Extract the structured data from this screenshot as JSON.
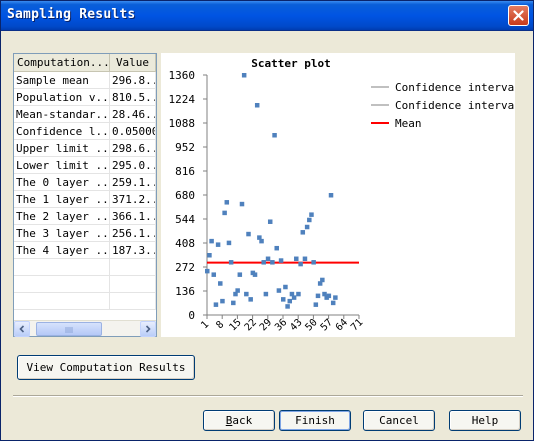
{
  "window": {
    "title": "Sampling Results"
  },
  "grid": {
    "headers": [
      "Computation...",
      "Value"
    ],
    "rows": [
      [
        "Sample mean",
        "296.8..."
      ],
      [
        "Population v...",
        "810.5..."
      ],
      [
        "Mean-standar...",
        "28.46..."
      ],
      [
        "Confidence l...",
        "0.05000"
      ],
      [
        "Upper limit ...",
        "298.6..."
      ],
      [
        "Lower limit ...",
        "295.0..."
      ],
      [
        "The 0 layer ...",
        "259.1..."
      ],
      [
        "The 1 layer ...",
        "371.2..."
      ],
      [
        "The 2 layer ...",
        "366.1..."
      ],
      [
        "The 3 layer ...",
        "256.1..."
      ],
      [
        "The 4 layer ...",
        "187.3..."
      ],
      [
        "",
        ""
      ],
      [
        "",
        ""
      ],
      [
        "",
        ""
      ]
    ]
  },
  "chart_data": {
    "type": "scatter",
    "title": "Scatter plot",
    "xlabel": "",
    "ylabel": "",
    "ylim": [
      0,
      1360
    ],
    "yticks": [
      0,
      136,
      272,
      408,
      544,
      680,
      816,
      952,
      1088,
      1224,
      1360
    ],
    "xlim": [
      1,
      71
    ],
    "xticks": [
      "1",
      "8",
      "15",
      "22",
      "29",
      "36",
      "43",
      "50",
      "57",
      "64",
      "71"
    ],
    "series": [
      {
        "name": "",
        "points": [
          [
            1,
            250
          ],
          [
            2,
            340
          ],
          [
            3,
            420
          ],
          [
            4,
            230
          ],
          [
            5,
            60
          ],
          [
            6,
            400
          ],
          [
            7,
            180
          ],
          [
            8,
            80
          ],
          [
            9,
            580
          ],
          [
            10,
            640
          ],
          [
            11,
            410
          ],
          [
            12,
            300
          ],
          [
            13,
            70
          ],
          [
            14,
            120
          ],
          [
            15,
            140
          ],
          [
            16,
            230
          ],
          [
            17,
            630
          ],
          [
            18,
            1360
          ],
          [
            19,
            120
          ],
          [
            20,
            460
          ],
          [
            21,
            90
          ],
          [
            22,
            240
          ],
          [
            23,
            230
          ],
          [
            24,
            1190
          ],
          [
            25,
            440
          ],
          [
            26,
            420
          ],
          [
            27,
            300
          ],
          [
            28,
            120
          ],
          [
            29,
            320
          ],
          [
            30,
            530
          ],
          [
            31,
            300
          ],
          [
            32,
            1020
          ],
          [
            33,
            380
          ],
          [
            34,
            140
          ],
          [
            35,
            310
          ],
          [
            36,
            90
          ],
          [
            37,
            160
          ],
          [
            38,
            50
          ],
          [
            39,
            80
          ],
          [
            40,
            120
          ],
          [
            41,
            100
          ],
          [
            42,
            320
          ],
          [
            43,
            120
          ],
          [
            44,
            290
          ],
          [
            45,
            470
          ],
          [
            46,
            320
          ],
          [
            47,
            500
          ],
          [
            48,
            540
          ],
          [
            49,
            570
          ],
          [
            50,
            300
          ],
          [
            51,
            60
          ],
          [
            52,
            110
          ],
          [
            53,
            180
          ],
          [
            54,
            200
          ],
          [
            55,
            120
          ],
          [
            56,
            100
          ],
          [
            57,
            110
          ],
          [
            58,
            680
          ],
          [
            59,
            70
          ],
          [
            60,
            100
          ]
        ]
      }
    ],
    "mean": 296.8,
    "legend": [
      {
        "label": "Confidence interval",
        "color": "#c0c0c0"
      },
      {
        "label": "Confidence interval",
        "color": "#c0c0c0"
      },
      {
        "label": "Mean",
        "color": "#ff0000"
      }
    ],
    "legend_position": "top-right",
    "point_color": "#4f81bd"
  },
  "buttons": {
    "view": "View Computation Results",
    "back_prefix": "",
    "back_accel": "B",
    "back_rest": "ack",
    "finish": "Finish",
    "cancel": "Cancel",
    "help": "Help"
  }
}
